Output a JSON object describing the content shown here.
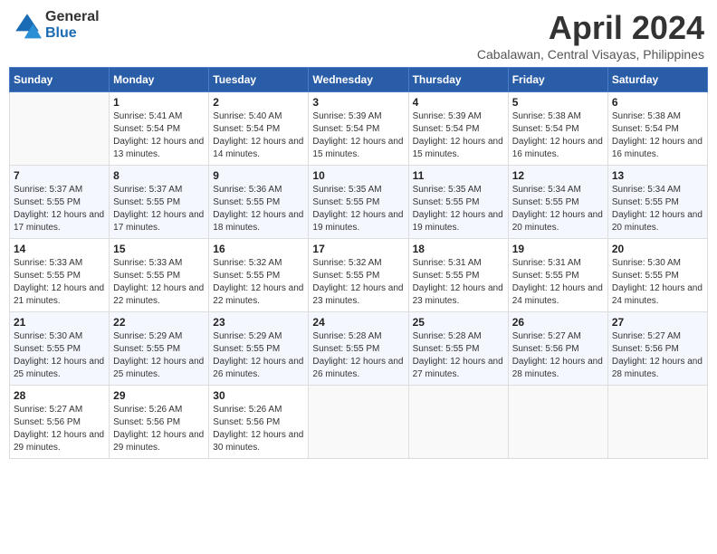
{
  "header": {
    "logo_general": "General",
    "logo_blue": "Blue",
    "title": "April 2024",
    "location": "Cabalawan, Central Visayas, Philippines"
  },
  "weekdays": [
    "Sunday",
    "Monday",
    "Tuesday",
    "Wednesday",
    "Thursday",
    "Friday",
    "Saturday"
  ],
  "weeks": [
    [
      {
        "day": "",
        "sunrise": "",
        "sunset": "",
        "daylight": ""
      },
      {
        "day": "1",
        "sunrise": "Sunrise: 5:41 AM",
        "sunset": "Sunset: 5:54 PM",
        "daylight": "Daylight: 12 hours and 13 minutes."
      },
      {
        "day": "2",
        "sunrise": "Sunrise: 5:40 AM",
        "sunset": "Sunset: 5:54 PM",
        "daylight": "Daylight: 12 hours and 14 minutes."
      },
      {
        "day": "3",
        "sunrise": "Sunrise: 5:39 AM",
        "sunset": "Sunset: 5:54 PM",
        "daylight": "Daylight: 12 hours and 15 minutes."
      },
      {
        "day": "4",
        "sunrise": "Sunrise: 5:39 AM",
        "sunset": "Sunset: 5:54 PM",
        "daylight": "Daylight: 12 hours and 15 minutes."
      },
      {
        "day": "5",
        "sunrise": "Sunrise: 5:38 AM",
        "sunset": "Sunset: 5:54 PM",
        "daylight": "Daylight: 12 hours and 16 minutes."
      },
      {
        "day": "6",
        "sunrise": "Sunrise: 5:38 AM",
        "sunset": "Sunset: 5:54 PM",
        "daylight": "Daylight: 12 hours and 16 minutes."
      }
    ],
    [
      {
        "day": "7",
        "sunrise": "Sunrise: 5:37 AM",
        "sunset": "Sunset: 5:55 PM",
        "daylight": "Daylight: 12 hours and 17 minutes."
      },
      {
        "day": "8",
        "sunrise": "Sunrise: 5:37 AM",
        "sunset": "Sunset: 5:55 PM",
        "daylight": "Daylight: 12 hours and 17 minutes."
      },
      {
        "day": "9",
        "sunrise": "Sunrise: 5:36 AM",
        "sunset": "Sunset: 5:55 PM",
        "daylight": "Daylight: 12 hours and 18 minutes."
      },
      {
        "day": "10",
        "sunrise": "Sunrise: 5:35 AM",
        "sunset": "Sunset: 5:55 PM",
        "daylight": "Daylight: 12 hours and 19 minutes."
      },
      {
        "day": "11",
        "sunrise": "Sunrise: 5:35 AM",
        "sunset": "Sunset: 5:55 PM",
        "daylight": "Daylight: 12 hours and 19 minutes."
      },
      {
        "day": "12",
        "sunrise": "Sunrise: 5:34 AM",
        "sunset": "Sunset: 5:55 PM",
        "daylight": "Daylight: 12 hours and 20 minutes."
      },
      {
        "day": "13",
        "sunrise": "Sunrise: 5:34 AM",
        "sunset": "Sunset: 5:55 PM",
        "daylight": "Daylight: 12 hours and 20 minutes."
      }
    ],
    [
      {
        "day": "14",
        "sunrise": "Sunrise: 5:33 AM",
        "sunset": "Sunset: 5:55 PM",
        "daylight": "Daylight: 12 hours and 21 minutes."
      },
      {
        "day": "15",
        "sunrise": "Sunrise: 5:33 AM",
        "sunset": "Sunset: 5:55 PM",
        "daylight": "Daylight: 12 hours and 22 minutes."
      },
      {
        "day": "16",
        "sunrise": "Sunrise: 5:32 AM",
        "sunset": "Sunset: 5:55 PM",
        "daylight": "Daylight: 12 hours and 22 minutes."
      },
      {
        "day": "17",
        "sunrise": "Sunrise: 5:32 AM",
        "sunset": "Sunset: 5:55 PM",
        "daylight": "Daylight: 12 hours and 23 minutes."
      },
      {
        "day": "18",
        "sunrise": "Sunrise: 5:31 AM",
        "sunset": "Sunset: 5:55 PM",
        "daylight": "Daylight: 12 hours and 23 minutes."
      },
      {
        "day": "19",
        "sunrise": "Sunrise: 5:31 AM",
        "sunset": "Sunset: 5:55 PM",
        "daylight": "Daylight: 12 hours and 24 minutes."
      },
      {
        "day": "20",
        "sunrise": "Sunrise: 5:30 AM",
        "sunset": "Sunset: 5:55 PM",
        "daylight": "Daylight: 12 hours and 24 minutes."
      }
    ],
    [
      {
        "day": "21",
        "sunrise": "Sunrise: 5:30 AM",
        "sunset": "Sunset: 5:55 PM",
        "daylight": "Daylight: 12 hours and 25 minutes."
      },
      {
        "day": "22",
        "sunrise": "Sunrise: 5:29 AM",
        "sunset": "Sunset: 5:55 PM",
        "daylight": "Daylight: 12 hours and 25 minutes."
      },
      {
        "day": "23",
        "sunrise": "Sunrise: 5:29 AM",
        "sunset": "Sunset: 5:55 PM",
        "daylight": "Daylight: 12 hours and 26 minutes."
      },
      {
        "day": "24",
        "sunrise": "Sunrise: 5:28 AM",
        "sunset": "Sunset: 5:55 PM",
        "daylight": "Daylight: 12 hours and 26 minutes."
      },
      {
        "day": "25",
        "sunrise": "Sunrise: 5:28 AM",
        "sunset": "Sunset: 5:55 PM",
        "daylight": "Daylight: 12 hours and 27 minutes."
      },
      {
        "day": "26",
        "sunrise": "Sunrise: 5:27 AM",
        "sunset": "Sunset: 5:56 PM",
        "daylight": "Daylight: 12 hours and 28 minutes."
      },
      {
        "day": "27",
        "sunrise": "Sunrise: 5:27 AM",
        "sunset": "Sunset: 5:56 PM",
        "daylight": "Daylight: 12 hours and 28 minutes."
      }
    ],
    [
      {
        "day": "28",
        "sunrise": "Sunrise: 5:27 AM",
        "sunset": "Sunset: 5:56 PM",
        "daylight": "Daylight: 12 hours and 29 minutes."
      },
      {
        "day": "29",
        "sunrise": "Sunrise: 5:26 AM",
        "sunset": "Sunset: 5:56 PM",
        "daylight": "Daylight: 12 hours and 29 minutes."
      },
      {
        "day": "30",
        "sunrise": "Sunrise: 5:26 AM",
        "sunset": "Sunset: 5:56 PM",
        "daylight": "Daylight: 12 hours and 30 minutes."
      },
      {
        "day": "",
        "sunrise": "",
        "sunset": "",
        "daylight": ""
      },
      {
        "day": "",
        "sunrise": "",
        "sunset": "",
        "daylight": ""
      },
      {
        "day": "",
        "sunrise": "",
        "sunset": "",
        "daylight": ""
      },
      {
        "day": "",
        "sunrise": "",
        "sunset": "",
        "daylight": ""
      }
    ]
  ]
}
